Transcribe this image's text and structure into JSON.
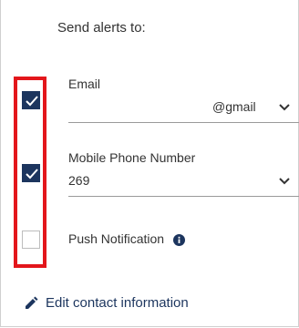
{
  "heading": "Send alerts to:",
  "email": {
    "label": "Email",
    "value": "@gmail",
    "checked": true
  },
  "phone": {
    "label": "Mobile Phone Number",
    "value": "269",
    "checked": true
  },
  "push": {
    "label": "Push Notification",
    "checked": false
  },
  "edit_link": "Edit contact information",
  "colors": {
    "accent": "#1c355e",
    "highlight": "#e3161b"
  }
}
